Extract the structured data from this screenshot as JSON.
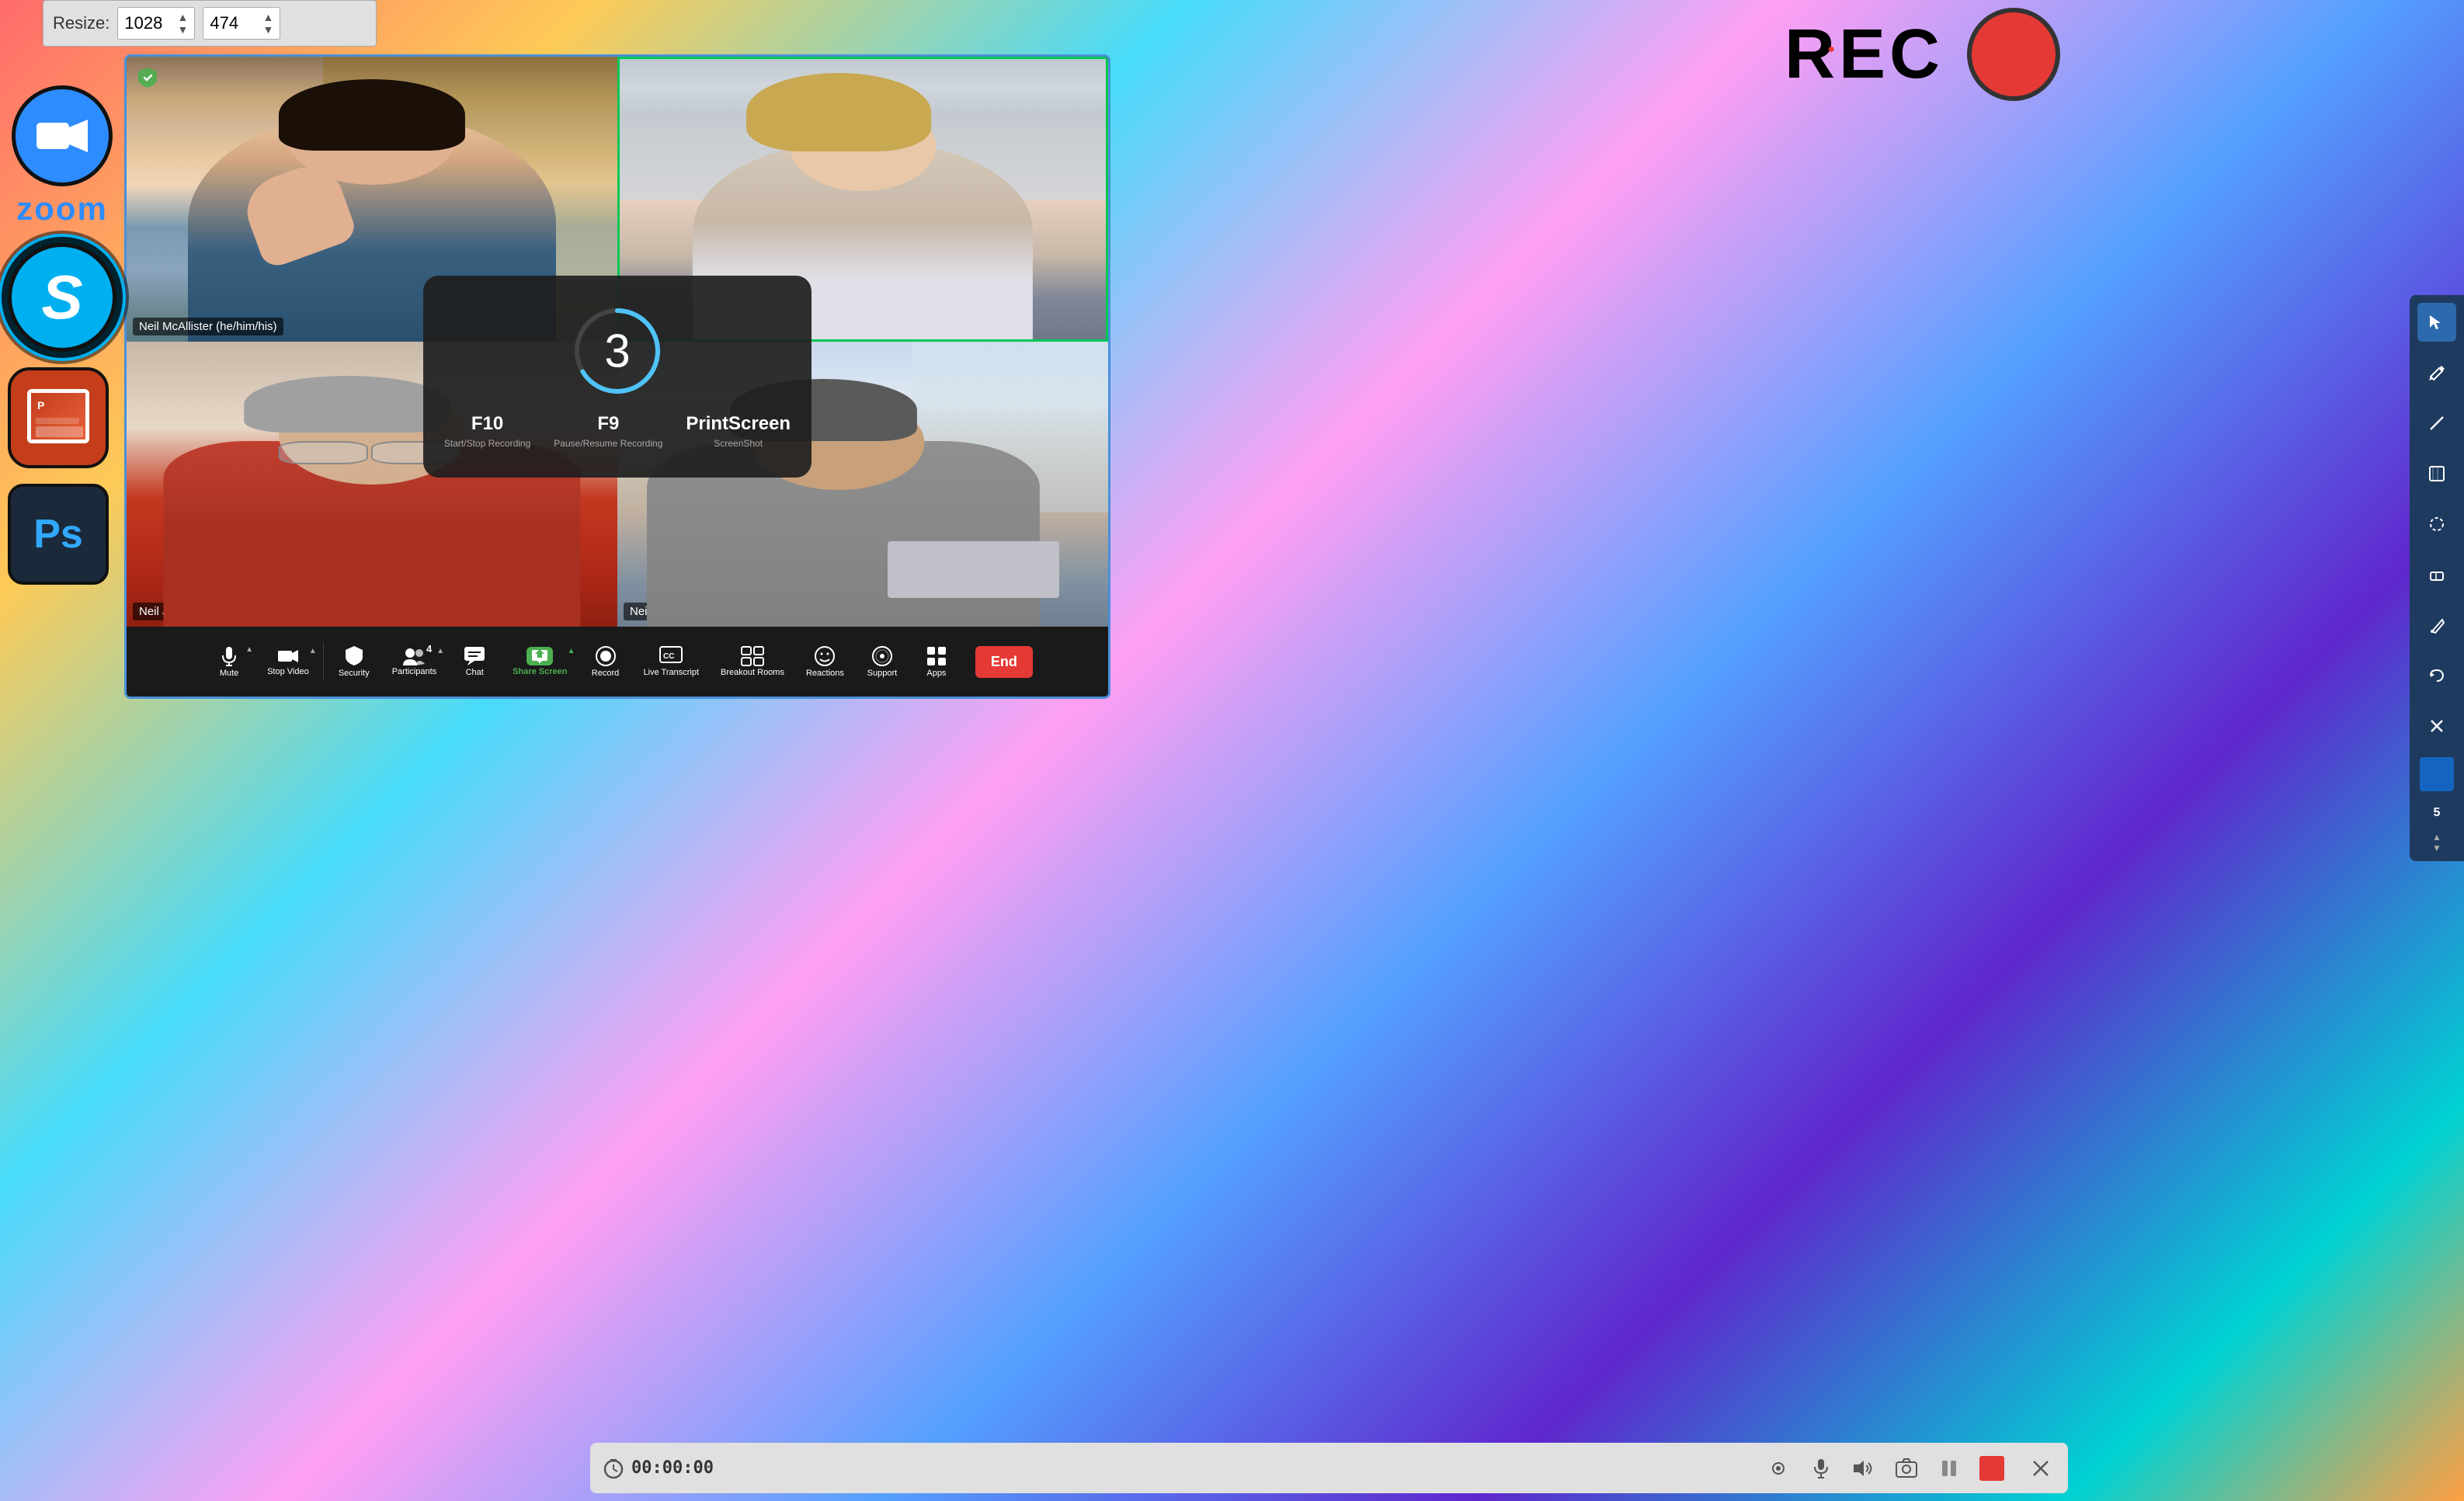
{
  "resize_bar": {
    "label": "Resize:",
    "width_value": "1028",
    "height_value": "474"
  },
  "rec_indicator": {
    "text": "REC",
    "dot_label": "recording-dot"
  },
  "zoom_window": {
    "shield_icon": "shield-icon",
    "participants": [
      {
        "id": "top-left",
        "name": "Neil McAllister (he/him/his)",
        "active_speaker": false
      },
      {
        "id": "top-right",
        "name": "",
        "active_speaker": true
      },
      {
        "id": "bottom-left",
        "name": "Neil J. Rubenking",
        "active_speaker": false
      },
      {
        "id": "bottom-right",
        "name": "Neil McAllister (he/him/his)",
        "active_speaker": false
      }
    ],
    "countdown": {
      "number": "3",
      "keys": [
        {
          "key": "F10",
          "desc": "Start/Stop Recording"
        },
        {
          "key": "F9",
          "desc": "Pause/Resume Recording"
        },
        {
          "key": "PrintScreen",
          "desc": "ScreenShot"
        }
      ]
    },
    "toolbar": {
      "items": [
        {
          "id": "mute",
          "label": "Mute",
          "icon": "🎤",
          "has_arrow": true
        },
        {
          "id": "stop-video",
          "label": "Stop Video",
          "icon": "📷",
          "has_arrow": true
        },
        {
          "id": "security",
          "label": "Security",
          "icon": "🛡"
        },
        {
          "id": "participants",
          "label": "Participants",
          "icon": "👥",
          "badge": "4",
          "has_arrow": true
        },
        {
          "id": "chat",
          "label": "Chat",
          "icon": "💬"
        },
        {
          "id": "share-screen",
          "label": "Share Screen",
          "icon": "⬆",
          "has_arrow": true,
          "active": true
        },
        {
          "id": "record",
          "label": "Record",
          "icon": "⏺"
        },
        {
          "id": "live-transcript",
          "label": "Live Transcript",
          "icon": "CC"
        },
        {
          "id": "breakout-rooms",
          "label": "Breakout Rooms",
          "icon": "⊞"
        },
        {
          "id": "reactions",
          "label": "Reactions",
          "icon": "😊"
        },
        {
          "id": "support",
          "label": "Support",
          "icon": "🙂"
        },
        {
          "id": "apps",
          "label": "Apps",
          "icon": "⊞"
        }
      ],
      "end_button": "End"
    }
  },
  "left_sidebar": {
    "apps": [
      {
        "id": "zoom",
        "label": "zoom"
      },
      {
        "id": "skype",
        "label": "S"
      },
      {
        "id": "powerpoint",
        "label": "P"
      },
      {
        "id": "photoshop",
        "label": "Ps"
      }
    ]
  },
  "right_toolbar": {
    "tools": [
      {
        "id": "cursor",
        "icon": "↖",
        "active": true
      },
      {
        "id": "pencil",
        "icon": "✏"
      },
      {
        "id": "line",
        "icon": "/"
      },
      {
        "id": "shape",
        "icon": "⬡"
      },
      {
        "id": "lasso",
        "icon": "⊙"
      },
      {
        "id": "eraser",
        "icon": "⬜"
      },
      {
        "id": "pen",
        "icon": "🖊"
      },
      {
        "id": "undo",
        "icon": "↩"
      },
      {
        "id": "close",
        "icon": "✕"
      },
      {
        "id": "color",
        "icon": "⬛",
        "is_blue": true
      },
      {
        "id": "count",
        "label": "5"
      }
    ]
  },
  "recording_bar": {
    "timer": "00:00:00",
    "controls": [
      {
        "id": "camera",
        "icon": "👤"
      },
      {
        "id": "mic",
        "icon": "🎤"
      },
      {
        "id": "volume",
        "icon": "🔊"
      },
      {
        "id": "screenshot",
        "icon": "📷"
      },
      {
        "id": "pause",
        "icon": "⏸"
      },
      {
        "id": "stop",
        "icon": "⬛",
        "is_stop": true
      }
    ],
    "close_icon": "✕"
  },
  "toolbar_labels": {
    "mute": "Mute",
    "stop_video": "Stop Video",
    "security": "Security",
    "participants": "Participants",
    "chat": "Chat",
    "share_screen": "Share Screen",
    "record": "Record",
    "live_transcript": "Live Transcript",
    "breakout_rooms": "Breakout Rooms",
    "reactions": "Reactions",
    "support": "Support",
    "apps": "Apps",
    "end": "End"
  }
}
